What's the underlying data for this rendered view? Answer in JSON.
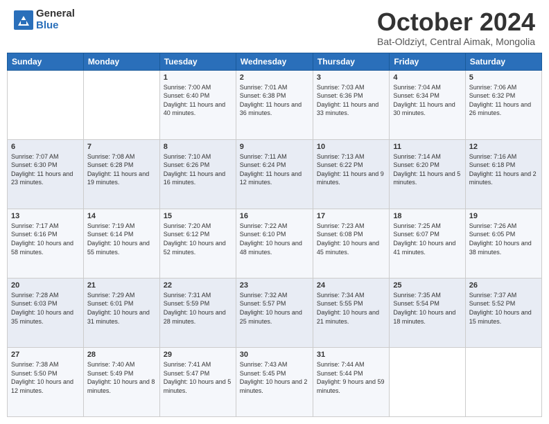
{
  "header": {
    "logo_general": "General",
    "logo_blue": "Blue",
    "month_title": "October 2024",
    "subtitle": "Bat-Oldziyt, Central Aimak, Mongolia"
  },
  "days_of_week": [
    "Sunday",
    "Monday",
    "Tuesday",
    "Wednesday",
    "Thursday",
    "Friday",
    "Saturday"
  ],
  "weeks": [
    [
      {
        "day": "",
        "info": ""
      },
      {
        "day": "",
        "info": ""
      },
      {
        "day": "1",
        "info": "Sunrise: 7:00 AM\nSunset: 6:40 PM\nDaylight: 11 hours and 40 minutes."
      },
      {
        "day": "2",
        "info": "Sunrise: 7:01 AM\nSunset: 6:38 PM\nDaylight: 11 hours and 36 minutes."
      },
      {
        "day": "3",
        "info": "Sunrise: 7:03 AM\nSunset: 6:36 PM\nDaylight: 11 hours and 33 minutes."
      },
      {
        "day": "4",
        "info": "Sunrise: 7:04 AM\nSunset: 6:34 PM\nDaylight: 11 hours and 30 minutes."
      },
      {
        "day": "5",
        "info": "Sunrise: 7:06 AM\nSunset: 6:32 PM\nDaylight: 11 hours and 26 minutes."
      }
    ],
    [
      {
        "day": "6",
        "info": "Sunrise: 7:07 AM\nSunset: 6:30 PM\nDaylight: 11 hours and 23 minutes."
      },
      {
        "day": "7",
        "info": "Sunrise: 7:08 AM\nSunset: 6:28 PM\nDaylight: 11 hours and 19 minutes."
      },
      {
        "day": "8",
        "info": "Sunrise: 7:10 AM\nSunset: 6:26 PM\nDaylight: 11 hours and 16 minutes."
      },
      {
        "day": "9",
        "info": "Sunrise: 7:11 AM\nSunset: 6:24 PM\nDaylight: 11 hours and 12 minutes."
      },
      {
        "day": "10",
        "info": "Sunrise: 7:13 AM\nSunset: 6:22 PM\nDaylight: 11 hours and 9 minutes."
      },
      {
        "day": "11",
        "info": "Sunrise: 7:14 AM\nSunset: 6:20 PM\nDaylight: 11 hours and 5 minutes."
      },
      {
        "day": "12",
        "info": "Sunrise: 7:16 AM\nSunset: 6:18 PM\nDaylight: 11 hours and 2 minutes."
      }
    ],
    [
      {
        "day": "13",
        "info": "Sunrise: 7:17 AM\nSunset: 6:16 PM\nDaylight: 10 hours and 58 minutes."
      },
      {
        "day": "14",
        "info": "Sunrise: 7:19 AM\nSunset: 6:14 PM\nDaylight: 10 hours and 55 minutes."
      },
      {
        "day": "15",
        "info": "Sunrise: 7:20 AM\nSunset: 6:12 PM\nDaylight: 10 hours and 52 minutes."
      },
      {
        "day": "16",
        "info": "Sunrise: 7:22 AM\nSunset: 6:10 PM\nDaylight: 10 hours and 48 minutes."
      },
      {
        "day": "17",
        "info": "Sunrise: 7:23 AM\nSunset: 6:08 PM\nDaylight: 10 hours and 45 minutes."
      },
      {
        "day": "18",
        "info": "Sunrise: 7:25 AM\nSunset: 6:07 PM\nDaylight: 10 hours and 41 minutes."
      },
      {
        "day": "19",
        "info": "Sunrise: 7:26 AM\nSunset: 6:05 PM\nDaylight: 10 hours and 38 minutes."
      }
    ],
    [
      {
        "day": "20",
        "info": "Sunrise: 7:28 AM\nSunset: 6:03 PM\nDaylight: 10 hours and 35 minutes."
      },
      {
        "day": "21",
        "info": "Sunrise: 7:29 AM\nSunset: 6:01 PM\nDaylight: 10 hours and 31 minutes."
      },
      {
        "day": "22",
        "info": "Sunrise: 7:31 AM\nSunset: 5:59 PM\nDaylight: 10 hours and 28 minutes."
      },
      {
        "day": "23",
        "info": "Sunrise: 7:32 AM\nSunset: 5:57 PM\nDaylight: 10 hours and 25 minutes."
      },
      {
        "day": "24",
        "info": "Sunrise: 7:34 AM\nSunset: 5:55 PM\nDaylight: 10 hours and 21 minutes."
      },
      {
        "day": "25",
        "info": "Sunrise: 7:35 AM\nSunset: 5:54 PM\nDaylight: 10 hours and 18 minutes."
      },
      {
        "day": "26",
        "info": "Sunrise: 7:37 AM\nSunset: 5:52 PM\nDaylight: 10 hours and 15 minutes."
      }
    ],
    [
      {
        "day": "27",
        "info": "Sunrise: 7:38 AM\nSunset: 5:50 PM\nDaylight: 10 hours and 12 minutes."
      },
      {
        "day": "28",
        "info": "Sunrise: 7:40 AM\nSunset: 5:49 PM\nDaylight: 10 hours and 8 minutes."
      },
      {
        "day": "29",
        "info": "Sunrise: 7:41 AM\nSunset: 5:47 PM\nDaylight: 10 hours and 5 minutes."
      },
      {
        "day": "30",
        "info": "Sunrise: 7:43 AM\nSunset: 5:45 PM\nDaylight: 10 hours and 2 minutes."
      },
      {
        "day": "31",
        "info": "Sunrise: 7:44 AM\nSunset: 5:44 PM\nDaylight: 9 hours and 59 minutes."
      },
      {
        "day": "",
        "info": ""
      },
      {
        "day": "",
        "info": ""
      }
    ]
  ]
}
